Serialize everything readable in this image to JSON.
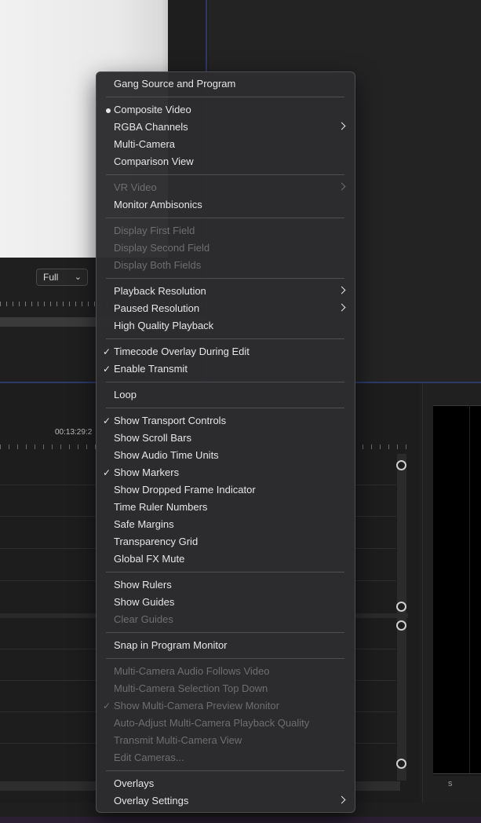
{
  "monitor": {
    "zoom_value": "Full"
  },
  "timeline": {
    "timecode": "00:13:29:2"
  },
  "audio_meter": {
    "label": "s"
  },
  "colors": {
    "menu_background": "#2c2c2e",
    "menu_text": "#e6e6e6",
    "menu_text_disabled": "#6e6e70",
    "panel_focus_border": "#2c3a6a"
  },
  "menu": {
    "gang": "Gang Source and Program",
    "composite_video": "Composite Video",
    "rgba_channels": "RGBA Channels",
    "multi_camera": "Multi-Camera",
    "comparison_view": "Comparison View",
    "vr_video": "VR Video",
    "monitor_ambisonics": "Monitor Ambisonics",
    "display_first_field": "Display First Field",
    "display_second_field": "Display Second Field",
    "display_both_fields": "Display Both Fields",
    "playback_resolution": "Playback Resolution",
    "paused_resolution": "Paused Resolution",
    "high_quality_playback": "High Quality Playback",
    "timecode_overlay": "Timecode Overlay During Edit",
    "enable_transmit": "Enable Transmit",
    "loop": "Loop",
    "show_transport_controls": "Show Transport Controls",
    "show_scroll_bars": "Show Scroll Bars",
    "show_audio_time_units": "Show Audio Time Units",
    "show_markers": "Show Markers",
    "show_dropped_frame": "Show Dropped Frame Indicator",
    "time_ruler_numbers": "Time Ruler Numbers",
    "safe_margins": "Safe Margins",
    "transparency_grid": "Transparency Grid",
    "global_fx_mute": "Global FX Mute",
    "show_rulers": "Show Rulers",
    "show_guides": "Show Guides",
    "clear_guides": "Clear Guides",
    "snap_in_program_monitor": "Snap in Program Monitor",
    "mc_audio_follows_video": "Multi-Camera Audio Follows Video",
    "mc_selection_top_down": "Multi-Camera Selection Top Down",
    "show_mc_preview_monitor": "Show Multi-Camera Preview Monitor",
    "auto_adjust_mc_quality": "Auto-Adjust Multi-Camera Playback Quality",
    "transmit_mc_view": "Transmit Multi-Camera View",
    "edit_cameras": "Edit Cameras...",
    "overlays": "Overlays",
    "overlay_settings": "Overlay Settings",
    "check_glyph": "✓"
  }
}
